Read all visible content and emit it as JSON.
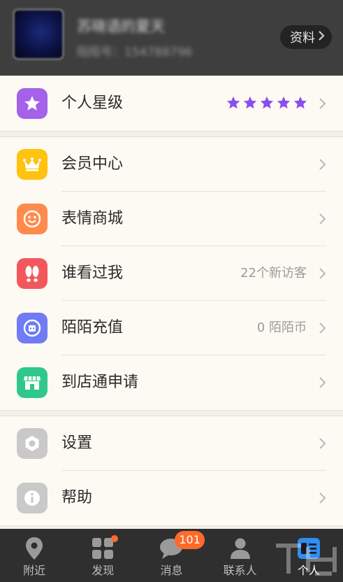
{
  "profile": {
    "nickname": "苏晓语的夏天",
    "momo_id": "陌陌号：154788796",
    "details_button": "资料"
  },
  "rows": {
    "star_level": {
      "label": "个人星级",
      "stars": 5,
      "star_color": "#8a4df0"
    },
    "member_center": {
      "label": "会员中心",
      "icon": "crown-icon",
      "color": "#ffc20e"
    },
    "emoji_store": {
      "label": "表情商城",
      "icon": "smile-icon",
      "color": "#ff8a4c"
    },
    "visitors": {
      "label": "谁看过我",
      "value": "22个新访客",
      "icon": "footprints-icon",
      "color": "#f2585b"
    },
    "recharge": {
      "label": "陌陌充值",
      "value": "0 陌陌币",
      "icon": "momo-coin-icon",
      "color": "#6f7cf5"
    },
    "store_apply": {
      "label": "到店通申请",
      "icon": "storefront-icon",
      "color": "#2ec98a"
    },
    "settings": {
      "label": "设置",
      "icon": "hexagon-gear-icon",
      "color": "#c9c9c9"
    },
    "help": {
      "label": "帮助",
      "icon": "info-icon",
      "color": "#c9c9c9"
    }
  },
  "tabs": [
    {
      "label": "附近",
      "icon": "location-pin-icon"
    },
    {
      "label": "发现",
      "icon": "grid-icon",
      "has_dot": true
    },
    {
      "label": "消息",
      "icon": "chat-bubble-icon",
      "badge": "101"
    },
    {
      "label": "联系人",
      "icon": "contacts-icon"
    },
    {
      "label": "个人",
      "icon": "profile-card-icon",
      "active": true
    }
  ],
  "colors": {
    "accent": "#ff6a2b",
    "active_tab": "#2f8cf0"
  }
}
